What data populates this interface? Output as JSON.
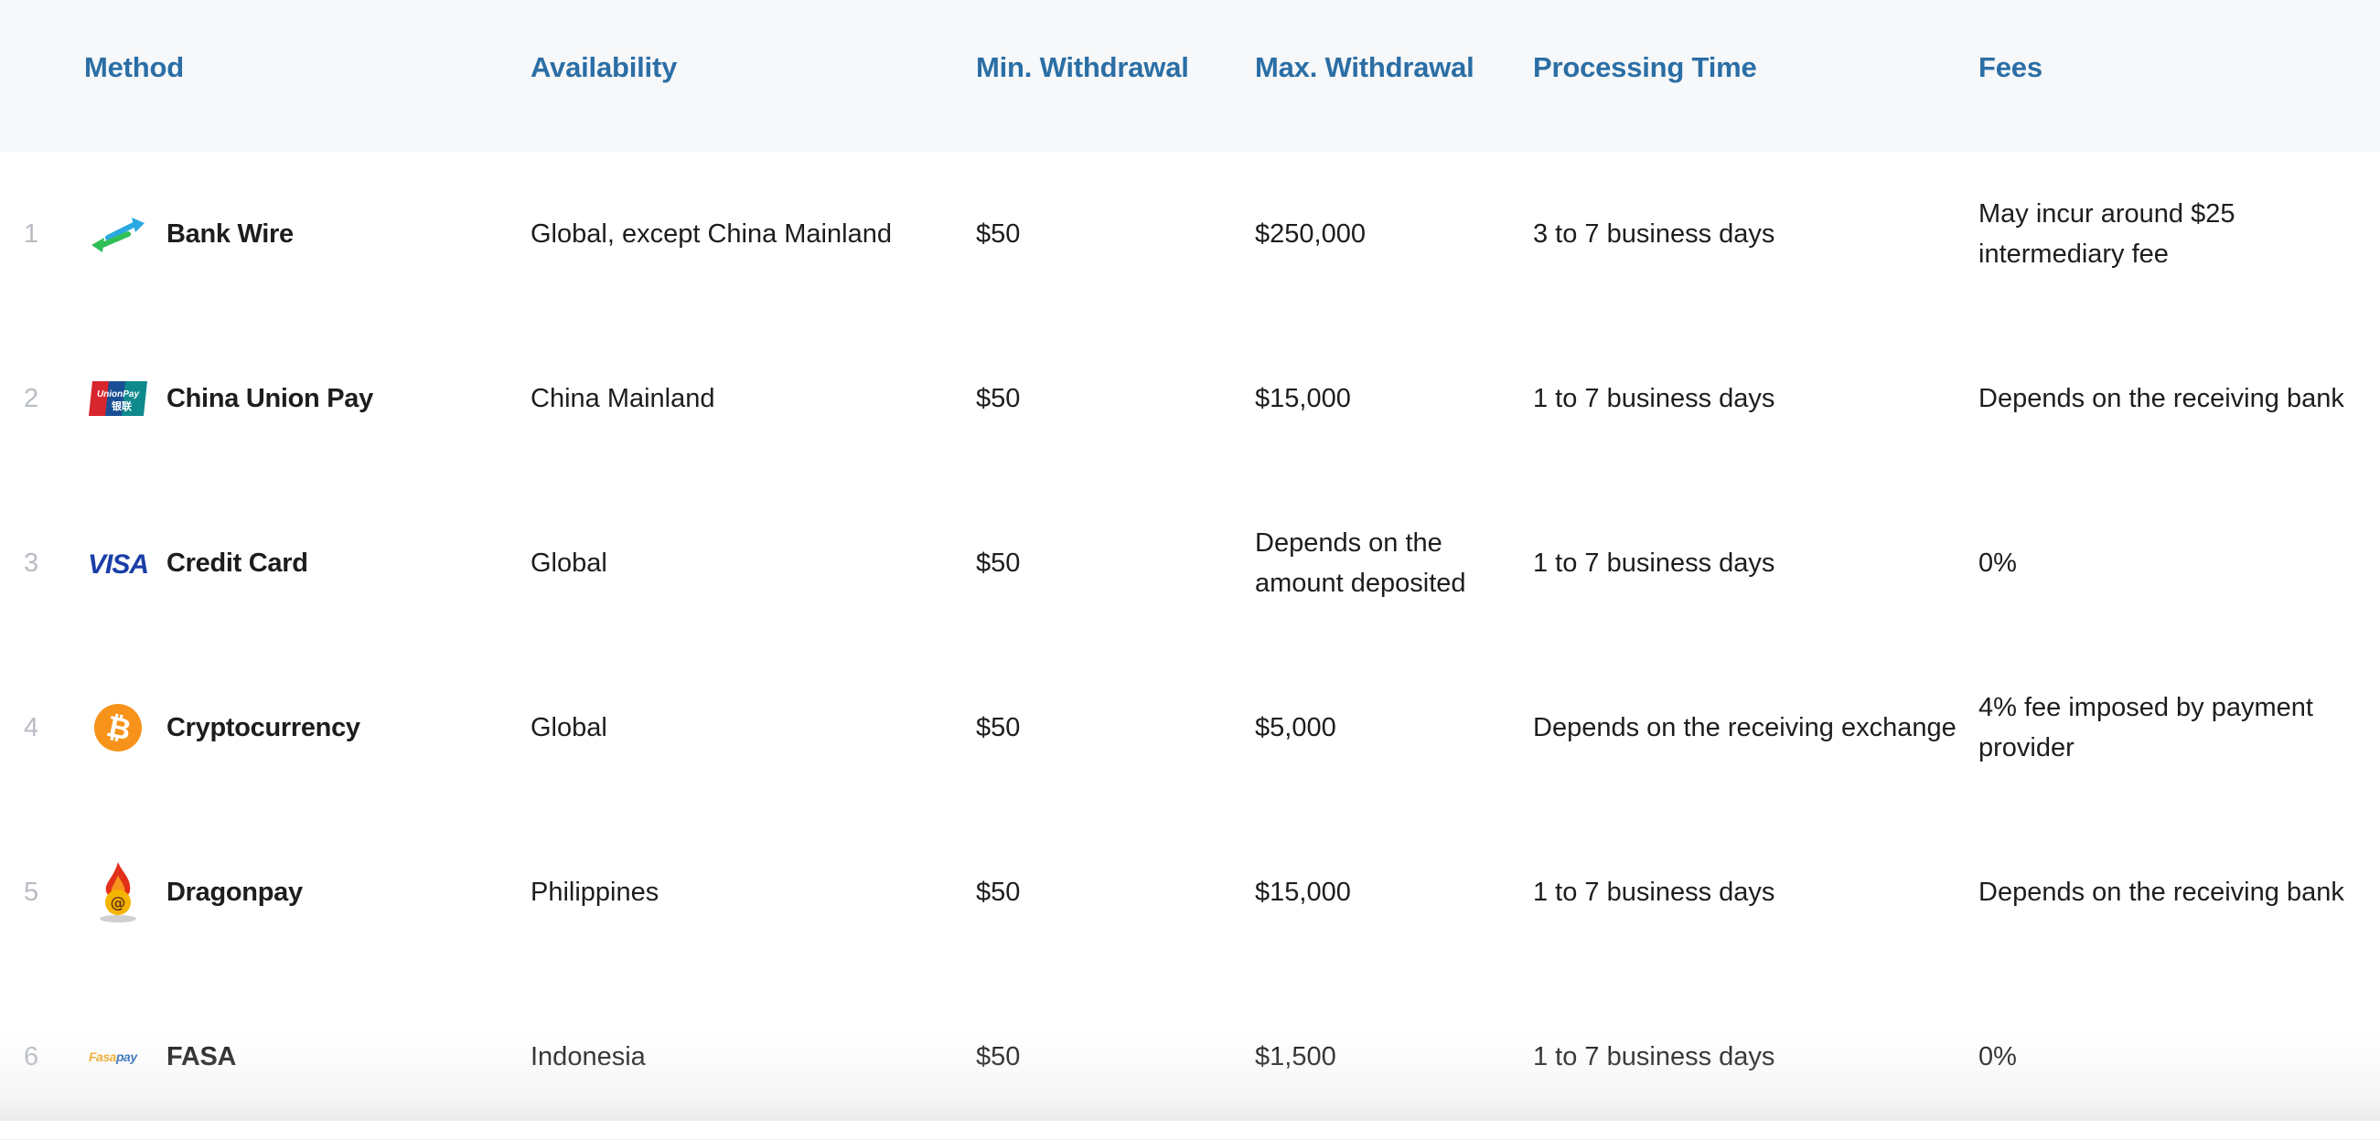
{
  "headers": {
    "method": "Method",
    "availability": "Availability",
    "min": "Min. Withdrawal",
    "max": "Max. Withdrawal",
    "processing": "Processing Time",
    "fees": "Fees"
  },
  "rows": [
    {
      "index": "1",
      "icon": "bank-wire-icon",
      "method": "Bank Wire",
      "availability": "Global, except China Mainland",
      "min": "$50",
      "max": "$250,000",
      "processing": "3 to 7 business days",
      "fees": "May incur around $25 intermediary fee"
    },
    {
      "index": "2",
      "icon": "unionpay-icon",
      "icon_text": "UnionPay 银联",
      "method": "China Union Pay",
      "availability": "China Mainland",
      "min": "$50",
      "max": "$15,000",
      "processing": "1 to 7 business days",
      "fees": "Depends on the receiving bank"
    },
    {
      "index": "3",
      "icon": "visa-icon",
      "icon_text": "VISA",
      "method": "Credit Card",
      "availability": "Global",
      "min": "$50",
      "max": "Depends on the amount deposited",
      "processing": "1 to 7 business days",
      "fees": "0%"
    },
    {
      "index": "4",
      "icon": "bitcoin-icon",
      "method": "Cryptocurrency",
      "availability": "Global",
      "min": "$50",
      "max": "$5,000",
      "processing": "Depends on the receiving exchange",
      "fees": "4% fee imposed by payment provider"
    },
    {
      "index": "5",
      "icon": "dragonpay-icon",
      "method": "Dragonpay",
      "availability": "Philippines",
      "min": "$50",
      "max": "$15,000",
      "processing": "1 to 7 business days",
      "fees": "Depends on the receiving bank"
    },
    {
      "index": "6",
      "icon": "fasapay-icon",
      "icon_text": "FasaPay",
      "method": "FASA",
      "availability": "Indonesia",
      "min": "$50",
      "max": "$1,500",
      "processing": "1 to 7 business days",
      "fees": "0%"
    }
  ],
  "colors": {
    "header_text": "#2b6ea5",
    "header_bg": "#f6f8fa",
    "index_text": "#b8bcc2"
  }
}
